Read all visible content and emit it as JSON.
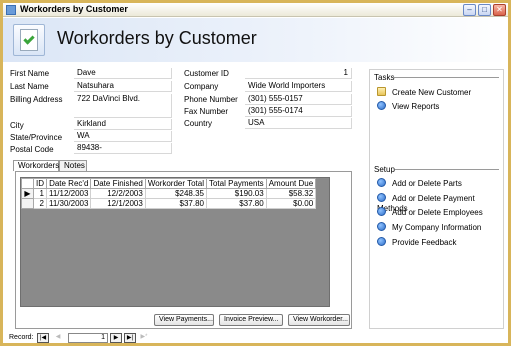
{
  "window": {
    "title": "Workorders by Customer"
  },
  "header": {
    "title": "Workorders by Customer"
  },
  "customer": {
    "labels": {
      "first_name": "First Name",
      "last_name": "Last Name",
      "billing_address": "Billing Address",
      "city": "City",
      "state": "State/Province",
      "postal": "Postal Code",
      "customer_id": "Customer ID",
      "company": "Company",
      "phone": "Phone Number",
      "fax": "Fax Number",
      "country": "Country"
    },
    "values": {
      "first_name": "Dave",
      "last_name": "Natsuhara",
      "billing_address": "722 DaVinci Blvd.",
      "city": "Kirkland",
      "state": "WA",
      "postal": "89438-",
      "customer_id": "1",
      "company": "Wide World Importers",
      "phone": "(301) 555-0157",
      "fax": "(301) 555-0174",
      "country": "USA"
    }
  },
  "tabs": [
    "Workorders",
    "Notes"
  ],
  "workorders": {
    "columns": [
      "ID",
      "Date Rec'd",
      "Date Finished",
      "Workorder Total",
      "Total Payments",
      "Amount Due"
    ],
    "rows": [
      {
        "id": "1",
        "date_recd": "11/12/2003",
        "date_finished": "12/2/2003",
        "total": "$248.35",
        "payments": "$190.03",
        "due": "$58.32"
      },
      {
        "id": "2",
        "date_recd": "11/30/2003",
        "date_finished": "12/1/2003",
        "total": "$37.80",
        "payments": "$37.80",
        "due": "$0.00"
      }
    ]
  },
  "buttons": {
    "view_payments": "View Payments...",
    "invoice_preview": "Invoice Preview...",
    "view_workorder": "View Workorder..."
  },
  "navigator": {
    "label": "Record:",
    "position": "1"
  },
  "sidebar": {
    "tasks_heading": "Tasks",
    "tasks": [
      {
        "label": "Create New Customer",
        "icon": "folder-icon"
      },
      {
        "label": "View Reports",
        "icon": "arrow-circle-icon"
      }
    ],
    "setup_heading": "Setup",
    "setup": [
      {
        "label": "Add or Delete Parts"
      },
      {
        "label": "Add or Delete Payment Methods"
      },
      {
        "label": "Add or Delete Employees"
      },
      {
        "label": "My Company Information"
      },
      {
        "label": "Provide Feedback"
      }
    ]
  }
}
